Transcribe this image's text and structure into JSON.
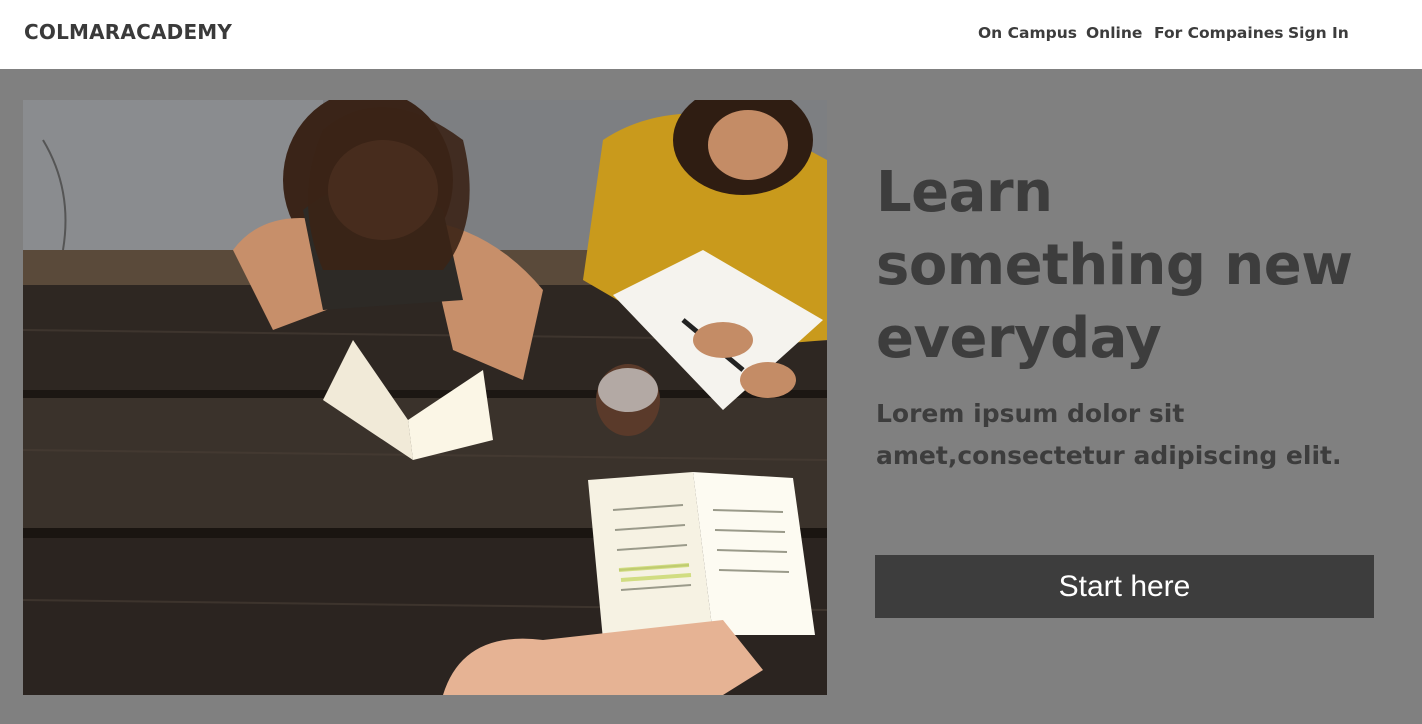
{
  "header": {
    "brand": "COLMARACADEMY",
    "nav": [
      {
        "label": "On Campus"
      },
      {
        "label": "Online"
      },
      {
        "label": "For Compaines"
      },
      {
        "label": "Sign In"
      }
    ]
  },
  "hero": {
    "image_subject": "students studying with books at a wooden picnic table",
    "headline": "Learn something new everyday",
    "subhead": "Lorem ipsum dolor sit amet,consectetur adipiscing elit.",
    "cta_label": "Start here"
  },
  "colors": {
    "page_background": "#808080",
    "header_background": "#ffffff",
    "text_dark": "#3d3d3d",
    "button_background": "#3d3d3d",
    "button_text": "#ffffff"
  }
}
